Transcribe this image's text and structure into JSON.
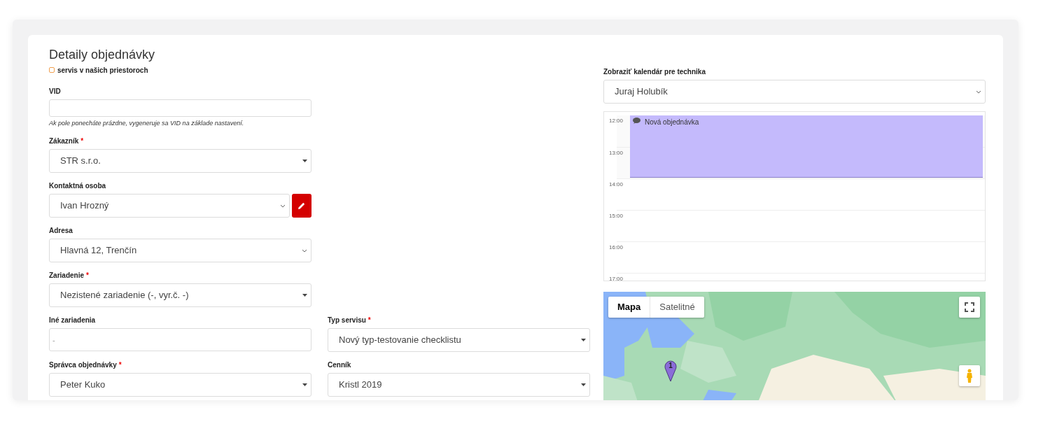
{
  "title": "Detaily objednávky",
  "onsite": {
    "label": "servis v našich priestoroch",
    "checked": false
  },
  "fields": [
    {
      "label": "VID",
      "kind": "input",
      "hint": "Ak pole ponecháte prázdne, vygeneruje sa VID na základe nastavení."
    },
    {
      "label": "Zákazník",
      "required_mark": "*",
      "kind": "combo",
      "value": "STR s.r.o."
    },
    {
      "label": "Kontaktná osoba",
      "kind": "select",
      "value": "Ivan Hrozný",
      "edit_button": true
    },
    {
      "label": "Adresa",
      "kind": "select",
      "value": "Hlavná 12, Trenčín"
    },
    {
      "label": "Zariadenie",
      "required_mark": "*",
      "kind": "combo",
      "value": "Nezistené zariadenie (-, vyr.č. -)"
    }
  ],
  "pairs": [
    {
      "label": "Iné zariadenia",
      "kind": "input",
      "placeholder": "-"
    },
    {
      "label": "Typ servisu",
      "required_mark": "*",
      "kind": "combo",
      "value": "Nový typ-testovanie checklistu"
    },
    {
      "label": "Správca objednávky",
      "required_mark": "*",
      "kind": "combo",
      "value": "Peter Kuko"
    },
    {
      "label": "Cenník",
      "kind": "combo",
      "value": "Kristl 2019"
    }
  ],
  "technician": {
    "label": "Zobraziť kalendár pre technika",
    "value": "Juraj Holubík"
  },
  "calendar": {
    "hours": [
      {
        "label": "12:00",
        "busy": true
      },
      {
        "label": "13:00",
        "busy": true
      },
      {
        "label": "14:00",
        "busy": false
      },
      {
        "label": "15:00",
        "busy": false
      },
      {
        "label": "16:00",
        "busy": false
      },
      {
        "label": "17:00",
        "busy": false
      }
    ],
    "event": {
      "title": "Nová objednávka",
      "color": "#c4bafc"
    }
  },
  "map": {
    "kind": "picture",
    "map_types": [
      {
        "label": "Mapa",
        "selected": true
      },
      {
        "label": "Satelitné",
        "selected": false
      }
    ],
    "marker_label": "1"
  }
}
